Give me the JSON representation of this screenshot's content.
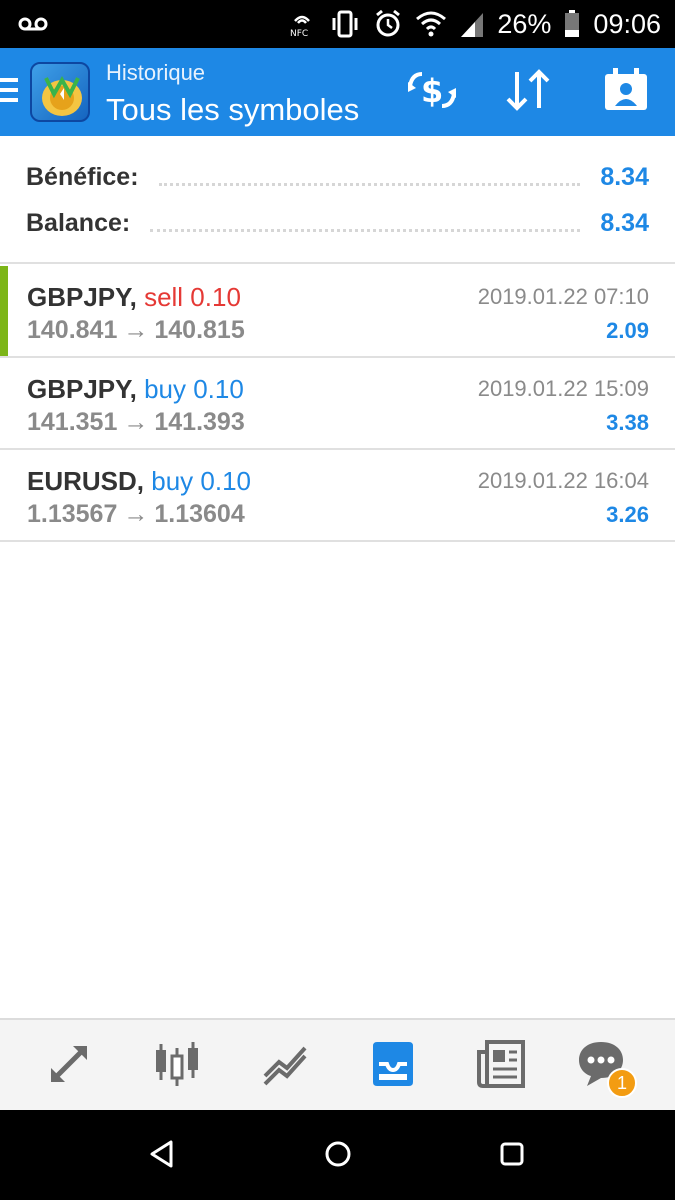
{
  "status_bar": {
    "battery_percent": "26%",
    "time": "09:06",
    "nfc_label": "NFC"
  },
  "appbar": {
    "subtitle": "Historique",
    "title": "Tous les symboles",
    "accent_color": "#1e88e5"
  },
  "summary": {
    "profit_label": "Bénéfice:",
    "profit_value": "8.34",
    "balance_label": "Balance:",
    "balance_value": "8.34"
  },
  "trades": [
    {
      "symbol": "GBPJPY,",
      "side": "sell 0.10",
      "open": "140.841",
      "arrow": "→",
      "close": "140.815",
      "time": "2019.01.22 07:10",
      "profit": "2.09"
    },
    {
      "symbol": "GBPJPY,",
      "side": "buy 0.10",
      "open": "141.351",
      "arrow": "→",
      "close": "141.393",
      "time": "2019.01.22 15:09",
      "profit": "3.38"
    },
    {
      "symbol": "EURUSD,",
      "side": "buy 0.10",
      "open": "1.13567",
      "arrow": "→",
      "close": "1.13604",
      "time": "2019.01.22 16:04",
      "profit": "3.26"
    }
  ],
  "tabbar": {
    "items": [
      "trade-icon",
      "quotes-icon",
      "chart-icon",
      "history-icon",
      "news-icon",
      "chat-icon"
    ],
    "active": "history-icon",
    "chat_badge": "1"
  },
  "navbar": {
    "items": [
      "back-icon",
      "home-icon",
      "recents-icon"
    ]
  }
}
